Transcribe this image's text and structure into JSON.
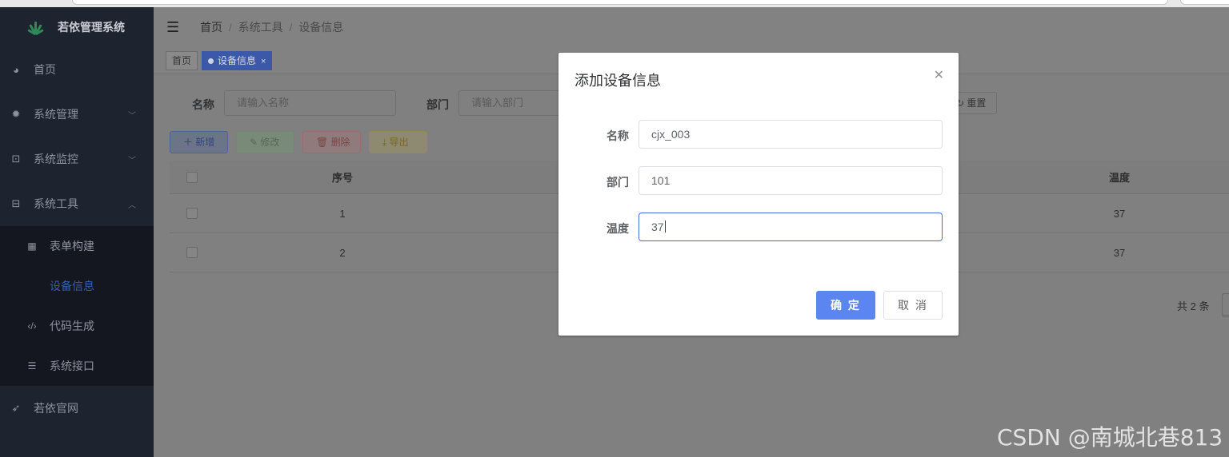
{
  "app": {
    "title": "若依管理系统"
  },
  "sidebar": {
    "items": [
      {
        "label": "首页",
        "icon": "dashboard-icon"
      },
      {
        "label": "系统管理",
        "icon": "gear-icon"
      },
      {
        "label": "系统监控",
        "icon": "monitor-icon"
      },
      {
        "label": "系统工具",
        "icon": "toolbox-icon"
      }
    ],
    "subitems": [
      {
        "label": "表单构建",
        "icon": "form-icon"
      },
      {
        "label": "设备信息",
        "icon": ""
      },
      {
        "label": "代码生成",
        "icon": "code-icon"
      },
      {
        "label": "系统接口",
        "icon": "sliders-icon"
      }
    ],
    "footer_item": {
      "label": "若依官网",
      "icon": "paper-plane-icon"
    }
  },
  "breadcrumb": [
    "首页",
    "系统工具",
    "设备信息"
  ],
  "tags": [
    {
      "label": "首页"
    },
    {
      "label": "设备信息"
    }
  ],
  "search": {
    "name_label": "名称",
    "name_placeholder": "请输入名称",
    "dept_label": "部门",
    "dept_placeholder": "请输入部门",
    "reset_label": "重置"
  },
  "toolbar": {
    "add_label": "新增",
    "edit_label": "修改",
    "delete_label": "删除",
    "export_label": "导出"
  },
  "table": {
    "columns": [
      "序号",
      "温度"
    ],
    "rows": [
      {
        "index": "1",
        "temp": "37"
      },
      {
        "index": "2",
        "temp": "37"
      }
    ]
  },
  "pagination": {
    "total_text": "共 2 条"
  },
  "dialog": {
    "title": "添加设备信息",
    "fields": [
      {
        "label": "名称",
        "value": "cjx_003"
      },
      {
        "label": "部门",
        "value": "101"
      },
      {
        "label": "温度",
        "value": "37"
      }
    ],
    "ok_label": "确 定",
    "cancel_label": "取 消"
  },
  "watermark": "CSDN @南城北巷813",
  "colors": {
    "sidebar_bg": "#1e2330",
    "primary": "#5b85f0",
    "active_menu": "#3c5cab"
  }
}
